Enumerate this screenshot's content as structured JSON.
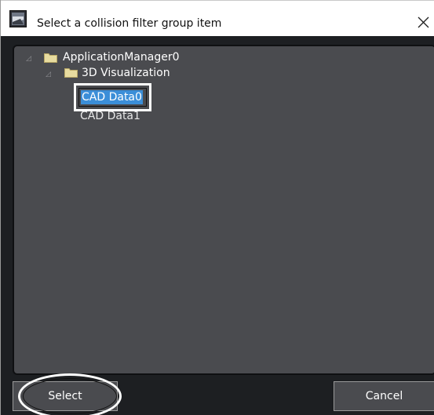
{
  "dialog": {
    "title": "Select a collision filter group item",
    "app_icon": "app-icon",
    "close_icon": "close-icon",
    "close_glyph": "✕"
  },
  "tree": {
    "root": {
      "label": "ApplicationManager0",
      "expander": "◿",
      "icon": "folder-icon",
      "expanded": true
    },
    "child": {
      "label": "3D Visualization",
      "expander": "◿",
      "icon": "folder-icon",
      "expanded": true
    },
    "items": [
      {
        "label": "CAD Data0",
        "selected": true
      },
      {
        "label": "CAD Data1",
        "selected": false
      }
    ]
  },
  "buttons": {
    "select_label": "Select",
    "cancel_label": "Cancel"
  },
  "colors": {
    "panel_bg": "#4a4b4f",
    "window_bg": "#1d1f22",
    "selection": "#3b8ed8",
    "folder": "#e8dca0"
  }
}
